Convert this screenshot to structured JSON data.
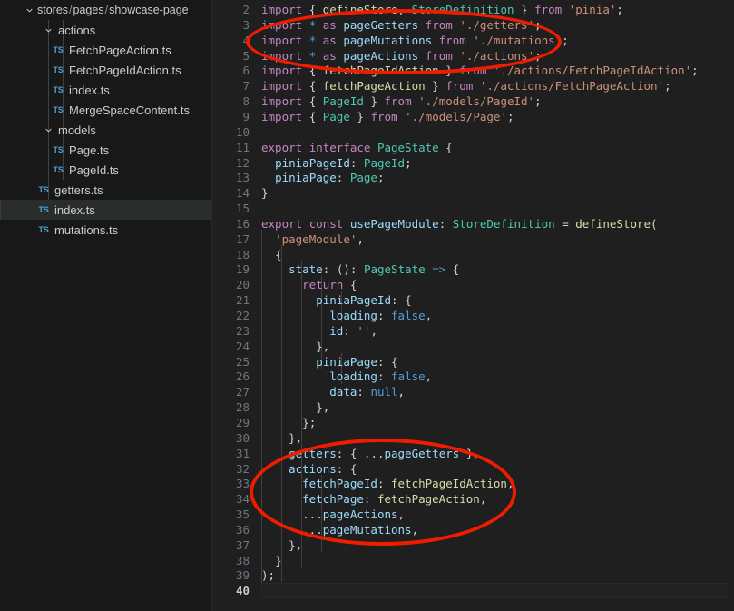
{
  "app": {
    "theme": "vscode-dark",
    "accent": "#f01c00"
  },
  "sidebar": {
    "root": {
      "label": "stores / pages / showcase-page",
      "parts": [
        "stores",
        "pages",
        "showcase-page"
      ]
    },
    "items": [
      {
        "label": "actions",
        "type": "folder",
        "depth": 1,
        "expanded": true,
        "icon": "chevron-down-icon"
      },
      {
        "label": "FetchPageAction.ts",
        "type": "file",
        "depth": 2,
        "icon": "ts-file-icon"
      },
      {
        "label": "FetchPageIdAction.ts",
        "type": "file",
        "depth": 2,
        "icon": "ts-file-icon"
      },
      {
        "label": "index.ts",
        "type": "file",
        "depth": 2,
        "icon": "ts-file-icon"
      },
      {
        "label": "MergeSpaceContent.ts",
        "type": "file",
        "depth": 2,
        "icon": "ts-file-icon"
      },
      {
        "label": "models",
        "type": "folder",
        "depth": 1,
        "expanded": true,
        "icon": "chevron-down-icon"
      },
      {
        "label": "Page.ts",
        "type": "file",
        "depth": 2,
        "icon": "ts-file-icon"
      },
      {
        "label": "PageId.ts",
        "type": "file",
        "depth": 2,
        "icon": "ts-file-icon"
      },
      {
        "label": "getters.ts",
        "type": "file",
        "depth": 1,
        "icon": "ts-file-icon"
      },
      {
        "label": "index.ts",
        "type": "file",
        "depth": 1,
        "icon": "ts-file-icon",
        "selected": true
      },
      {
        "label": "mutations.ts",
        "type": "file",
        "depth": 1,
        "icon": "ts-file-icon"
      }
    ],
    "file_badge": "TS"
  },
  "editor": {
    "language": "typescript",
    "active_line": 40,
    "first_visible_line": 2,
    "last_visible_line": 40,
    "lines": [
      {
        "n": 2,
        "text": "import { defineStore, StoreDefinition } from 'pinia';"
      },
      {
        "n": 3,
        "text": "import * as pageGetters from './getters';"
      },
      {
        "n": 4,
        "text": "import * as pageMutations from './mutations';"
      },
      {
        "n": 5,
        "text": "import * as pageActions from './actions';"
      },
      {
        "n": 6,
        "text": "import { fetchPageIdAction } from './actions/FetchPageIdAction';"
      },
      {
        "n": 7,
        "text": "import { fetchPageAction } from './actions/FetchPageAction';"
      },
      {
        "n": 8,
        "text": "import { PageId } from './models/PageId';"
      },
      {
        "n": 9,
        "text": "import { Page } from './models/Page';"
      },
      {
        "n": 10,
        "text": ""
      },
      {
        "n": 11,
        "text": "export interface PageState {"
      },
      {
        "n": 12,
        "text": "  piniaPageId: PageId;"
      },
      {
        "n": 13,
        "text": "  piniaPage: Page;"
      },
      {
        "n": 14,
        "text": "}"
      },
      {
        "n": 15,
        "text": ""
      },
      {
        "n": 16,
        "text": "export const usePageModule: StoreDefinition = defineStore("
      },
      {
        "n": 17,
        "text": "  'pageModule',"
      },
      {
        "n": 18,
        "text": "  {"
      },
      {
        "n": 19,
        "text": "    state: (): PageState => {"
      },
      {
        "n": 20,
        "text": "      return {"
      },
      {
        "n": 21,
        "text": "        piniaPageId: {"
      },
      {
        "n": 22,
        "text": "          loading: false,"
      },
      {
        "n": 23,
        "text": "          id: '',"
      },
      {
        "n": 24,
        "text": "        },"
      },
      {
        "n": 25,
        "text": "        piniaPage: {"
      },
      {
        "n": 26,
        "text": "          loading: false,"
      },
      {
        "n": 27,
        "text": "          data: null,"
      },
      {
        "n": 28,
        "text": "        },"
      },
      {
        "n": 29,
        "text": "      };"
      },
      {
        "n": 30,
        "text": "    },"
      },
      {
        "n": 31,
        "text": "    getters: { ...pageGetters },"
      },
      {
        "n": 32,
        "text": "    actions: {"
      },
      {
        "n": 33,
        "text": "      fetchPageId: fetchPageIdAction,"
      },
      {
        "n": 34,
        "text": "      fetchPage: fetchPageAction,"
      },
      {
        "n": 35,
        "text": "      ...pageActions,"
      },
      {
        "n": 36,
        "text": "      ...pageMutations,"
      },
      {
        "n": 37,
        "text": "    },"
      },
      {
        "n": 38,
        "text": "  }"
      },
      {
        "n": 39,
        "text": ");"
      },
      {
        "n": 40,
        "text": ""
      }
    ]
  },
  "annotations": [
    {
      "name": "highlight-imports-ellipse",
      "shape": "ellipse",
      "color": "#f01c00",
      "covers_lines": [
        3,
        4,
        5
      ]
    },
    {
      "name": "highlight-actions-ellipse",
      "shape": "ellipse",
      "color": "#f01c00",
      "covers_lines": [
        31,
        32,
        33,
        34,
        35,
        36
      ]
    }
  ]
}
